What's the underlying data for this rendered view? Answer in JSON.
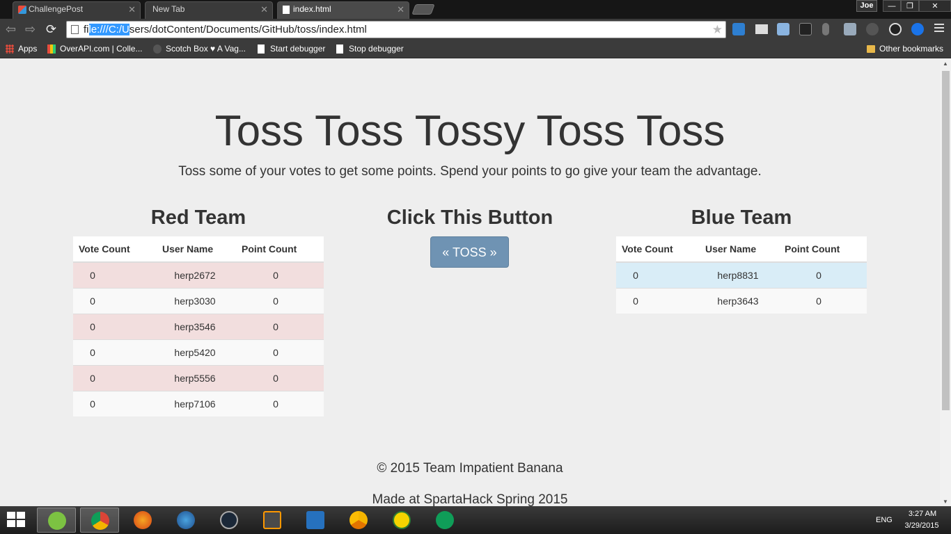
{
  "browser": {
    "tabs": [
      {
        "title": "ChallengePost",
        "active": false
      },
      {
        "title": "New Tab",
        "active": false
      },
      {
        "title": "index.html",
        "active": true
      }
    ],
    "profile": "Joe",
    "window_controls": {
      "minimize": "—",
      "maximize": "❐",
      "close": "✕"
    },
    "address": {
      "selected": "file:///C:/U",
      "prefix_unselected": "fi",
      "selected_part": "le:///C:/U",
      "rest": "sers/dotContent/Documents/GitHub/toss/index.html"
    },
    "bookmarks": [
      {
        "label": "Apps",
        "icon": "apps-grid-icon"
      },
      {
        "label": "OverAPI.com | Colle...",
        "icon": "overapi-icon"
      },
      {
        "label": "Scotch Box ♥ A Vag...",
        "icon": "scotch-icon"
      },
      {
        "label": "Start debugger",
        "icon": "page-icon"
      },
      {
        "label": "Stop debugger",
        "icon": "page-icon"
      }
    ],
    "other_bookmarks": "Other bookmarks"
  },
  "page": {
    "title": "Toss Toss Tossy Toss Toss",
    "subtitle": "Toss some of your votes to get some points. Spend your points to go give your team the advantage.",
    "red_team": {
      "title": "Red Team",
      "columns": [
        "Vote Count",
        "User Name",
        "Point Count"
      ],
      "rows": [
        {
          "votes": "0",
          "user": "herp2672",
          "points": "0"
        },
        {
          "votes": "0",
          "user": "herp3030",
          "points": "0"
        },
        {
          "votes": "0",
          "user": "herp3546",
          "points": "0"
        },
        {
          "votes": "0",
          "user": "herp5420",
          "points": "0"
        },
        {
          "votes": "0",
          "user": "herp5556",
          "points": "0"
        },
        {
          "votes": "0",
          "user": "herp7106",
          "points": "0"
        }
      ]
    },
    "center": {
      "title": "Click This Button",
      "button": "« TOSS »"
    },
    "blue_team": {
      "title": "Blue Team",
      "columns": [
        "Vote Count",
        "User Name",
        "Point Count"
      ],
      "rows": [
        {
          "votes": "0",
          "user": "herp8831",
          "points": "0"
        },
        {
          "votes": "0",
          "user": "herp3643",
          "points": "0"
        }
      ]
    },
    "footer": {
      "copyright": "© 2015 Team Impatient Banana",
      "made_at": "Made at SpartaHack Spring 2015"
    }
  },
  "taskbar": {
    "apps": [
      "clover-icon",
      "chrome-icon",
      "firefox-icon",
      "firefox-dev-icon",
      "steam-icon",
      "sublime-text-icon",
      "powershell-icon",
      "chrome-canary-icon",
      "hexchat-icon",
      "hangouts-icon"
    ],
    "language": "ENG",
    "time": "3:27 AM",
    "date": "3/29/2015"
  },
  "colors": {
    "red_row": "#f2dede",
    "blue_row": "#d9edf7",
    "button": "#6f93b3",
    "page_bg": "#eeeeee"
  }
}
